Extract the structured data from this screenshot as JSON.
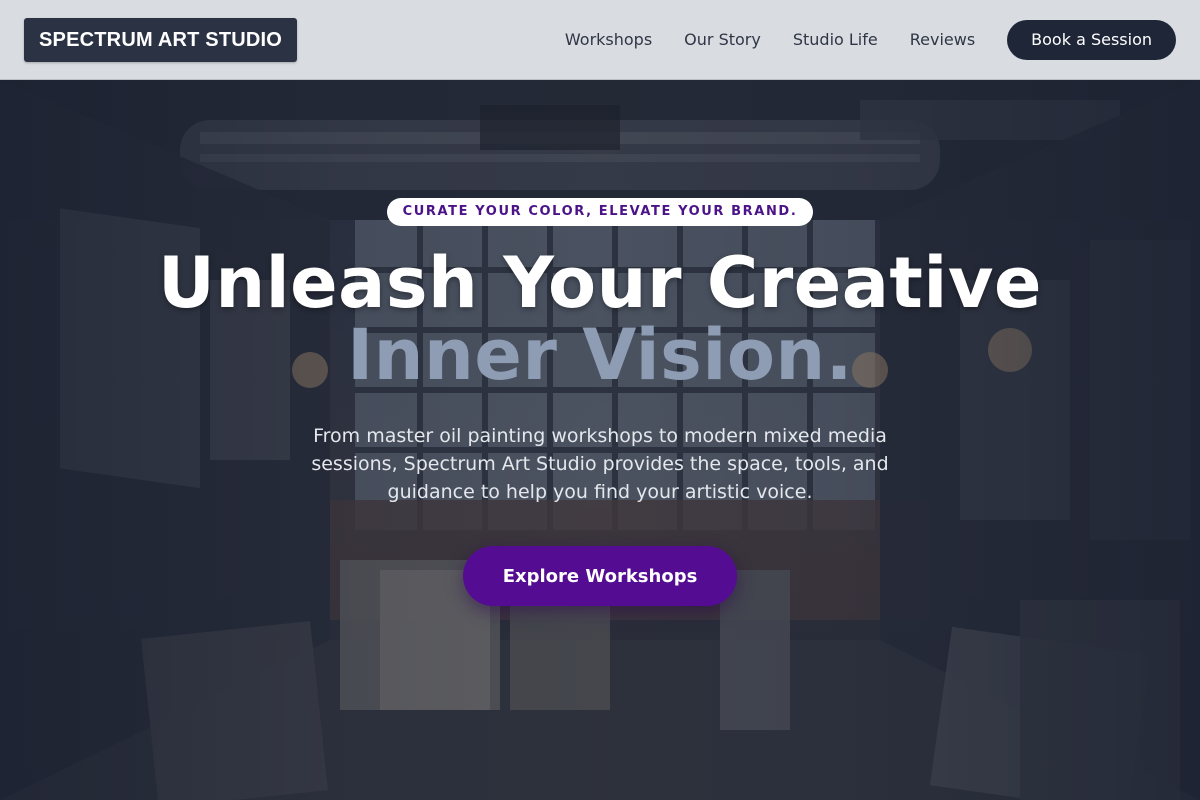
{
  "brand": {
    "logo_text": "SPECTRUM ART STUDIO"
  },
  "nav": {
    "links": [
      {
        "label": "Workshops"
      },
      {
        "label": "Our Story"
      },
      {
        "label": "Studio Life"
      },
      {
        "label": "Reviews"
      }
    ],
    "cta_label": "Book a Session"
  },
  "hero": {
    "tagline": "CURATE YOUR COLOR, ELEVATE YOUR BRAND.",
    "headline_line1": "Unleash Your Creative",
    "headline_line2": "Inner Vision.",
    "description": "From master oil painting workshops to modern mixed media sessions, Spectrum Art Studio provides the space, tools, and guidance to help you find your artistic voice.",
    "cta_label": "Explore Workshops",
    "background_image": "art studio warehouse interior with canvases and chandeliers"
  },
  "colors": {
    "header_bg": "#d9dce1",
    "logo_bg": "#2a3244",
    "nav_cta_bg": "#1e2638",
    "tagline_text": "#4b1388",
    "headline_secondary": "#8e9db4",
    "primary_cta_bg": "#540d92"
  }
}
